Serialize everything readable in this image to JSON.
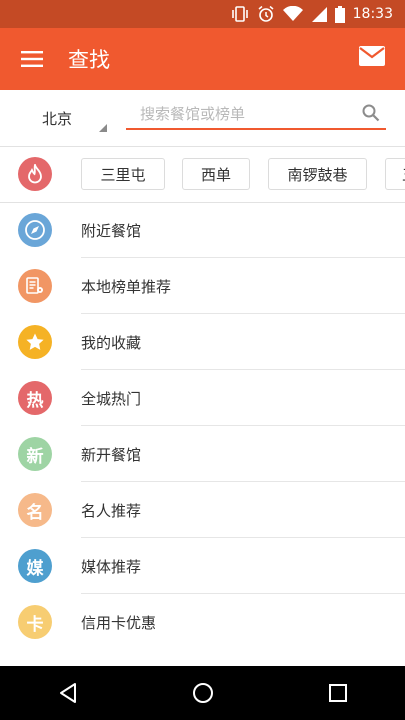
{
  "status_bar": {
    "time": "18:33"
  },
  "app_bar": {
    "title": "查找"
  },
  "search": {
    "city": "北京",
    "placeholder": "搜索餐馆或榜单"
  },
  "hot_areas": {
    "icon": "flame-icon",
    "tags": [
      "三里屯",
      "西单",
      "南锣鼓巷",
      "五"
    ]
  },
  "menu_items": [
    {
      "label": "附近餐馆",
      "icon": "compass-icon",
      "glyph": "",
      "color": "#6aa6d8"
    },
    {
      "label": "本地榜单推荐",
      "icon": "list-location-icon",
      "glyph": "",
      "color": "#f19664"
    },
    {
      "label": "我的收藏",
      "icon": "star-icon",
      "glyph": "",
      "color": "#f5b225"
    },
    {
      "label": "全城热门",
      "icon": "hot-icon",
      "glyph": "热",
      "color": "#e4686a"
    },
    {
      "label": "新开餐馆",
      "icon": "new-icon",
      "glyph": "新",
      "color": "#9ed4a4"
    },
    {
      "label": "名人推荐",
      "icon": "celebrity-icon",
      "glyph": "名",
      "color": "#f6b98a"
    },
    {
      "label": "媒体推荐",
      "icon": "media-icon",
      "glyph": "媒",
      "color": "#4e9fcf"
    },
    {
      "label": "信用卡优惠",
      "icon": "credit-card-icon",
      "glyph": "卡",
      "color": "#f7cd72"
    }
  ],
  "colors": {
    "status_bar": "#c44a25",
    "app_bar": "#f0592f",
    "accent": "#f0592f",
    "flame": "#e4686a"
  }
}
